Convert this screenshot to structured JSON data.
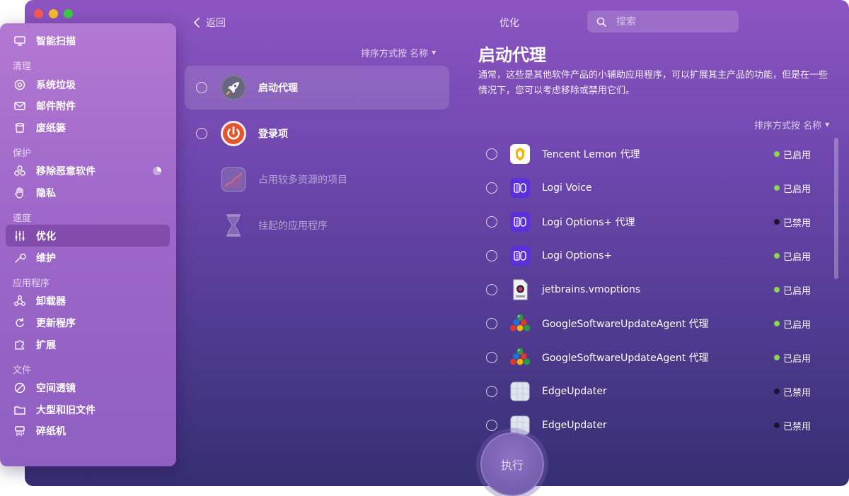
{
  "window": {
    "back_label": "返回",
    "title": "优化"
  },
  "search": {
    "placeholder": "搜索"
  },
  "sidebar": {
    "smart_scan": "智能扫描",
    "sections": {
      "clean": "清理",
      "protect": "保护",
      "speed": "速度",
      "apps": "应用程序",
      "files": "文件"
    },
    "items": {
      "system_junk": "系统垃圾",
      "mail_attachments": "邮件附件",
      "trash": "废纸篓",
      "malware_removal": "移除恶意软件",
      "privacy": "隐私",
      "optimization": "优化",
      "maintenance": "维护",
      "uninstaller": "卸载器",
      "updater": "更新程序",
      "extensions": "扩展",
      "space_lens": "空间透镜",
      "large_old_files": "大型和旧文件",
      "shredder": "碎纸机"
    }
  },
  "middle": {
    "sort_label": "排序方式按 名称",
    "categories": [
      {
        "label": "启动代理"
      },
      {
        "label": "登录项"
      },
      {
        "label": "占用较多资源的项目"
      },
      {
        "label": "挂起的应用程序"
      }
    ]
  },
  "detail": {
    "title": "启动代理",
    "description": "通常，这些是其他软件产品的小辅助应用程序，可以扩展其主产品的功能，但是在一些情况下，您可以考虑移除或禁用它们。",
    "sort_label": "排序方式按 名称",
    "items": [
      {
        "name": "Tencent Lemon 代理",
        "status": "已启用",
        "enabled": true,
        "icon": "lemon-icon"
      },
      {
        "name": "Logi Voice",
        "status": "已启用",
        "enabled": true,
        "icon": "logi-icon"
      },
      {
        "name": "Logi Options+ 代理",
        "status": "已禁用",
        "enabled": false,
        "icon": "logi-icon"
      },
      {
        "name": "Logi Options+",
        "status": "已启用",
        "enabled": true,
        "icon": "logi-icon"
      },
      {
        "name": "jetbrains.vmoptions",
        "status": "已启用",
        "enabled": true,
        "icon": "plist-file-icon"
      },
      {
        "name": "GoogleSoftwareUpdateAgent 代理",
        "status": "已启用",
        "enabled": true,
        "icon": "google-update-icon"
      },
      {
        "name": "GoogleSoftwareUpdateAgent 代理",
        "status": "已启用",
        "enabled": true,
        "icon": "google-update-icon"
      },
      {
        "name": "EdgeUpdater",
        "status": "已禁用",
        "enabled": false,
        "icon": "edge-updater-icon"
      },
      {
        "name": "EdgeUpdater",
        "status": "已禁用",
        "enabled": false,
        "icon": "edge-updater-icon"
      }
    ]
  },
  "run_button": {
    "label": "执行"
  },
  "colors": {
    "enabled_dot": "#8ed34f",
    "disabled_dot": "#1b1433"
  }
}
